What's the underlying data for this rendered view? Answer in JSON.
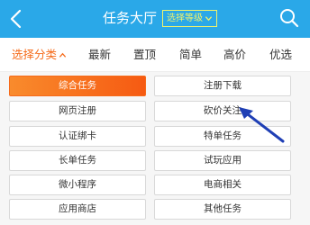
{
  "header": {
    "title": "任务大厅",
    "level_button": "选择等级",
    "background": "#2aa8e8"
  },
  "filters": [
    {
      "label": "选择分类",
      "active": true
    },
    {
      "label": "最新"
    },
    {
      "label": "置顶"
    },
    {
      "label": "简单"
    },
    {
      "label": "高价"
    },
    {
      "label": "优选"
    }
  ],
  "categories": [
    {
      "label": "综合任务",
      "selected": true
    },
    {
      "label": "注册下载"
    },
    {
      "label": "网页注册"
    },
    {
      "label": "砍价关注"
    },
    {
      "label": "认证绑卡"
    },
    {
      "label": "特单任务"
    },
    {
      "label": "长单任务"
    },
    {
      "label": "试玩应用"
    },
    {
      "label": "微小程序"
    },
    {
      "label": "电商相关"
    },
    {
      "label": "应用商店"
    },
    {
      "label": "其他任务"
    }
  ],
  "colors": {
    "accent": "#f56b1a",
    "arrow": "#1f3fb5"
  },
  "icons": {
    "back": "back-icon",
    "search": "search-icon",
    "level_chevron": "chevron-down-icon",
    "filter_caret": "chevron-up-icon"
  }
}
